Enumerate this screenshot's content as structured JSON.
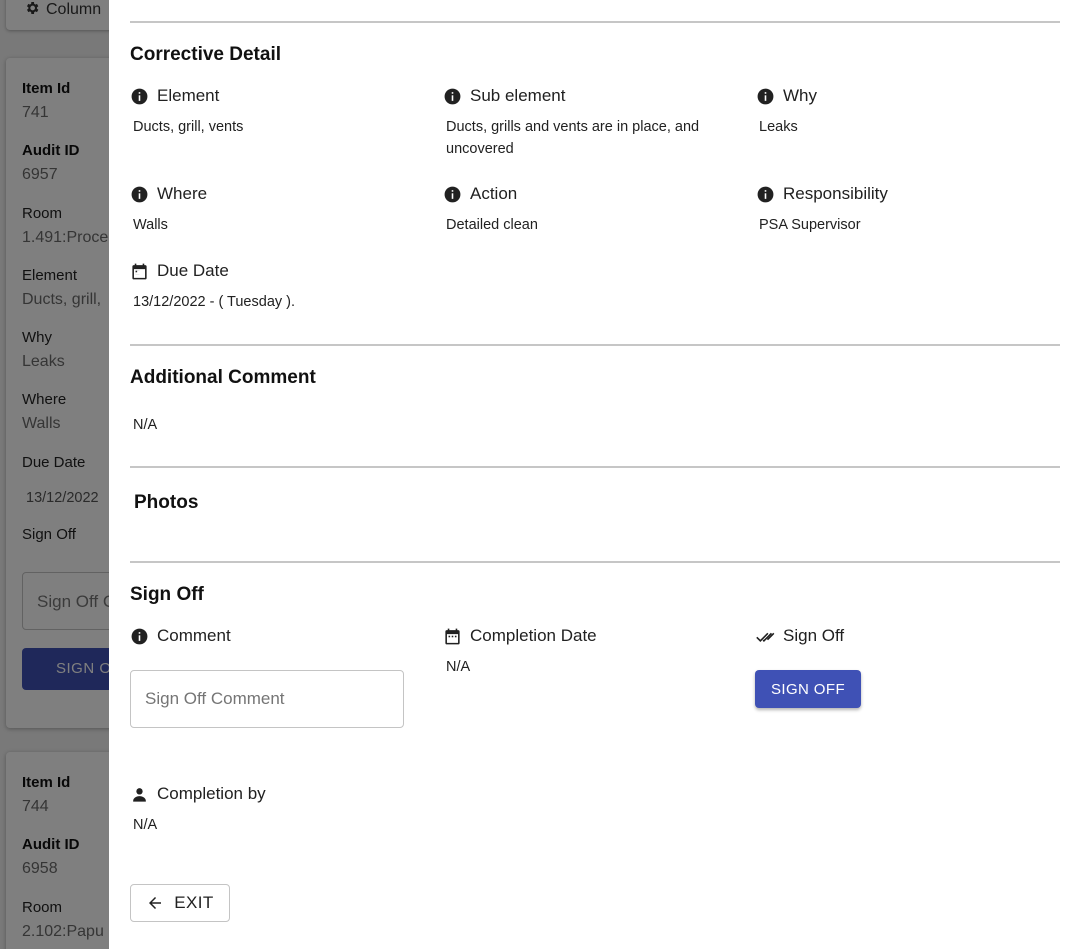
{
  "background": {
    "top_button_label": "Column",
    "card1": {
      "item_id_label": "Item Id",
      "item_id": "741",
      "audit_id_label": "Audit ID",
      "audit_id": "6957",
      "room_label": "Room",
      "room": "1.491:Proce",
      "element_label": "Element",
      "element": "Ducts, grill,",
      "why_label": "Why",
      "why": "Leaks",
      "where_label": "Where",
      "where": "Walls",
      "due_date_label": "Due Date",
      "due_date": "13/12/2022",
      "sign_off_label": "Sign Off",
      "sign_off_placeholder": "Sign Off C",
      "sign_off_button": "SIGN O"
    },
    "card2": {
      "item_id_label": "Item Id",
      "item_id": "744",
      "audit_id_label": "Audit ID",
      "audit_id": "6958",
      "room_label": "Room",
      "room": "2.102:Papu"
    }
  },
  "corrective": {
    "title": "Corrective Detail",
    "element_label": "Element",
    "element_value": "Ducts, grill, vents",
    "sub_element_label": "Sub element",
    "sub_element_value_line1": "Ducts, grills and vents are in place, and",
    "sub_element_value_line2": "uncovered",
    "why_label": "Why",
    "why_value": "Leaks",
    "where_label": "Where",
    "where_value": "Walls",
    "action_label": "Action",
    "action_value": "Detailed clean",
    "responsibility_label": "Responsibility",
    "responsibility_value": "PSA Supervisor",
    "due_date_label": "Due Date",
    "due_date_value": "13/12/2022 - ( Tuesday )."
  },
  "additional": {
    "title": "Additional Comment",
    "value": "N/A"
  },
  "photos": {
    "title": "Photos"
  },
  "signoff": {
    "title": "Sign Off",
    "comment_label": "Comment",
    "comment_placeholder": "Sign Off Comment",
    "completion_date_label": "Completion Date",
    "completion_date_value": "N/A",
    "sign_off_label": "Sign Off",
    "sign_off_button": "SIGN OFF",
    "completion_by_label": "Completion by",
    "completion_by_value": "N/A"
  },
  "footer": {
    "exit_label": "EXIT"
  },
  "colors": {
    "primary": "#3f51b5",
    "divider": "#c6c6c6",
    "overlay": "rgba(0,0,0,0.5)"
  }
}
